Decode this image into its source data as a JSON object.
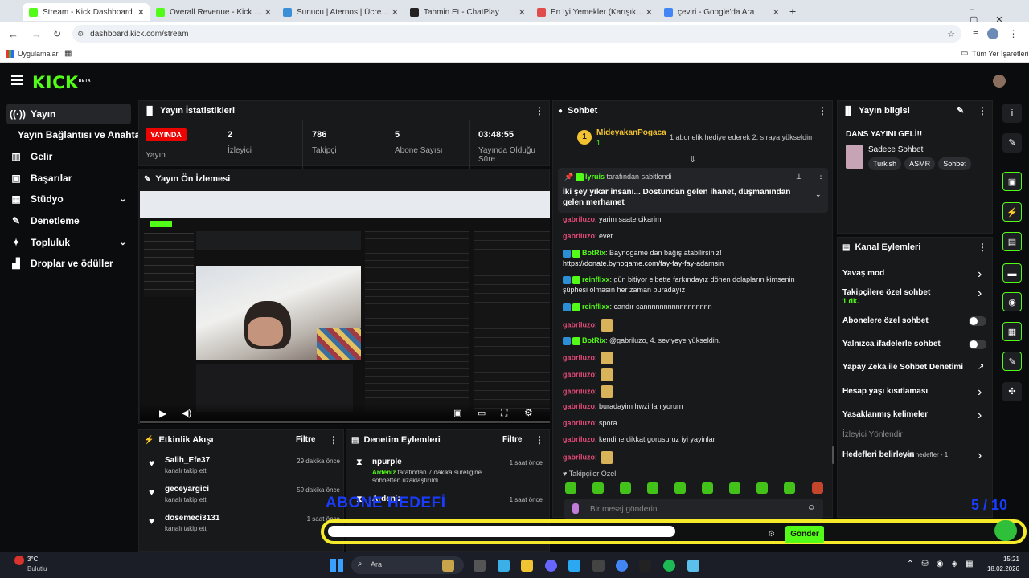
{
  "browser": {
    "tabs": [
      {
        "title": "Stream - Kick Dashboard",
        "color": "#53fc18",
        "active": true
      },
      {
        "title": "Overall Revenue - Kick Dashboa",
        "color": "#53fc18"
      },
      {
        "title": "Sunucu | Aternos | Ücretsiz Min",
        "color": "#3a8fd6"
      },
      {
        "title": "Tahmin Et - ChatPlay",
        "color": "#222"
      },
      {
        "title": "En İyi Yemekler (Karışık) - Tier L",
        "color": "#e04b4b"
      },
      {
        "title": "çeviri - Google'da Ara",
        "color": "#4285f4"
      }
    ],
    "new_tab": "+",
    "url": "dashboard.kick.com/stream",
    "bookmarks_apps": "Uygulamalar",
    "bookmarks_all": "Tüm Yer İşaretleri"
  },
  "kick": {
    "logo": "KICK",
    "logo_sup": "BETA",
    "menu_icon": "hamburger-icon"
  },
  "nav": [
    {
      "label": "Yayın",
      "icon": "((·))",
      "selected": true
    },
    {
      "label": "Yayın Bağlantısı ve Anahtarı",
      "icon": ""
    },
    {
      "label": "Gelir",
      "icon": "▥"
    },
    {
      "label": "Başarılar",
      "icon": "▣"
    },
    {
      "label": "Stüdyo",
      "icon": "▦",
      "chevron": true
    },
    {
      "label": "Denetleme",
      "icon": "✎"
    },
    {
      "label": "Topluluk",
      "icon": "✦",
      "chevron": true
    },
    {
      "label": "Droplar ve ödüller",
      "icon": "▟"
    }
  ],
  "stats_panel": {
    "title": "Yayın İstatistikleri",
    "live_badge": "YAYINDA",
    "live_label": "Yayın",
    "items": [
      {
        "value": "2",
        "label": "İzleyici"
      },
      {
        "value": "786",
        "label": "Takipçi"
      },
      {
        "value": "5",
        "label": "Abone Sayısı"
      },
      {
        "value": "03:48:55",
        "label": "Yayında Olduğu Süre"
      }
    ]
  },
  "preview_panel": {
    "title": "Yayın Ön İzlemesi"
  },
  "activity_panel": {
    "title": "Etkinlik Akışı",
    "filter": "Filtre",
    "items": [
      {
        "name": "Salih_Efe37",
        "sub": "kanalı takip etti",
        "time": "29 dakika önce"
      },
      {
        "name": "geceyargici",
        "sub": "kanalı takip etti",
        "time": "59 dakika önce"
      },
      {
        "name": "dosemeci3131",
        "sub": "kanalı takip etti",
        "time": "1 saat önce"
      }
    ]
  },
  "mod_panel": {
    "title": "Denetim Eylemleri",
    "filter": "Filtre",
    "items": [
      {
        "name": "npurple",
        "by": "Ardeniz",
        "desc": "tarafından 7 dakika süreliğine sohbetten uzaklaştırıldı",
        "time": "1 saat önce"
      },
      {
        "name": "Ardeniz",
        "by": "",
        "desc": "",
        "time": "1 saat önce"
      }
    ]
  },
  "chat": {
    "title": "Sohbet",
    "gift_user": "MideyakanPogaca",
    "gift_count": "1",
    "gift_text": "1 abonelik hediye ederek 2. sıraya yükseldin",
    "pinned_by": "lyruis",
    "pinned_label": "tarafından sabitlendi",
    "pinned_text": "İki şey yıkar insanı... Dostundan gelen ihanet, düşmanından gelen merhamet",
    "messages": [
      {
        "user": "gabriluzo",
        "text": ": yarim saate cikarim"
      },
      {
        "user": "gabriluzo",
        "text": ": evet"
      },
      {
        "user": "BotRix",
        "text": ": Baynogame dan bağış atabilirsiniz!",
        "link": "https://donate.bynogame.com/fay-fay-fay-adamsin",
        "bot": true
      },
      {
        "user": "reinflixx",
        "text": ": gün bitiyor elbette farkındayız dönen dolapların kimsenin şüphesi olmasın her zaman buradayız",
        "bot": true
      },
      {
        "user": "reinflixx",
        "text": ": candır cannnnnnnnnnnnnnnnn",
        "bot": true
      },
      {
        "user": "gabriluzo",
        "text": ":"
      },
      {
        "user": "BotRix",
        "text": ": @gabriluzo, 4. seviyeye yükseldin.",
        "bot": true
      },
      {
        "user": "gabriluzo",
        "text": ":"
      },
      {
        "user": "gabriluzo",
        "text": ":"
      },
      {
        "user": "gabriluzo",
        "text": ":"
      },
      {
        "user": "gabriluzo",
        "text": ": buradayim hwzirlaniyorum"
      },
      {
        "user": "gabriluzo",
        "text": ": spora"
      },
      {
        "user": "gabriluzo",
        "text": ": kendine dikkat gorusuruz iyi yayinlar"
      },
      {
        "user": "gabriluzo",
        "text": ":"
      }
    ],
    "followers_only": "Takipçiler Özel",
    "input_placeholder": "Bir mesaj gönderin"
  },
  "info_panel": {
    "title": "Yayın bilgisi",
    "stream_title": "DANS YAYINI GELİ!!",
    "category": "Sadece Sohbet",
    "tags": [
      "Turkish",
      "ASMR",
      "Sohbet"
    ]
  },
  "channel_actions": {
    "title": "Kanal Eylemleri",
    "items": [
      {
        "label": "Yavaş mod",
        "control": "arrow"
      },
      {
        "label": "Takipçilere özel sohbet",
        "sub": "1 dk.",
        "control": "arrow"
      },
      {
        "label": "Abonelere özel sohbet",
        "control": "toggle"
      },
      {
        "label": "Yalnızca ifadelerle sohbet",
        "control": "toggle"
      },
      {
        "label": "Yapay Zeka ile Sohbet Denetimi",
        "control": "external"
      },
      {
        "label": "Hesap yaşı kısıtlaması",
        "control": "arrow"
      },
      {
        "label": "Yasaklanmış kelimeler",
        "control": "arrow"
      },
      {
        "label": "İzleyici Yönlendir",
        "control": "none",
        "muted": true
      },
      {
        "label": "Hedefleri belirleyin",
        "control": "arrow",
        "extra": "Aktif hedefler - 1"
      }
    ]
  },
  "overlay": {
    "goal_text": "ABONE HEDEFİ",
    "goal_count": "5 / 10",
    "send_button": "Gönder"
  },
  "taskbar": {
    "weather_temp": "3°C",
    "weather_desc": "Bulutlu",
    "search": "Ara",
    "time": "15:21",
    "date": "18.02.2026"
  }
}
